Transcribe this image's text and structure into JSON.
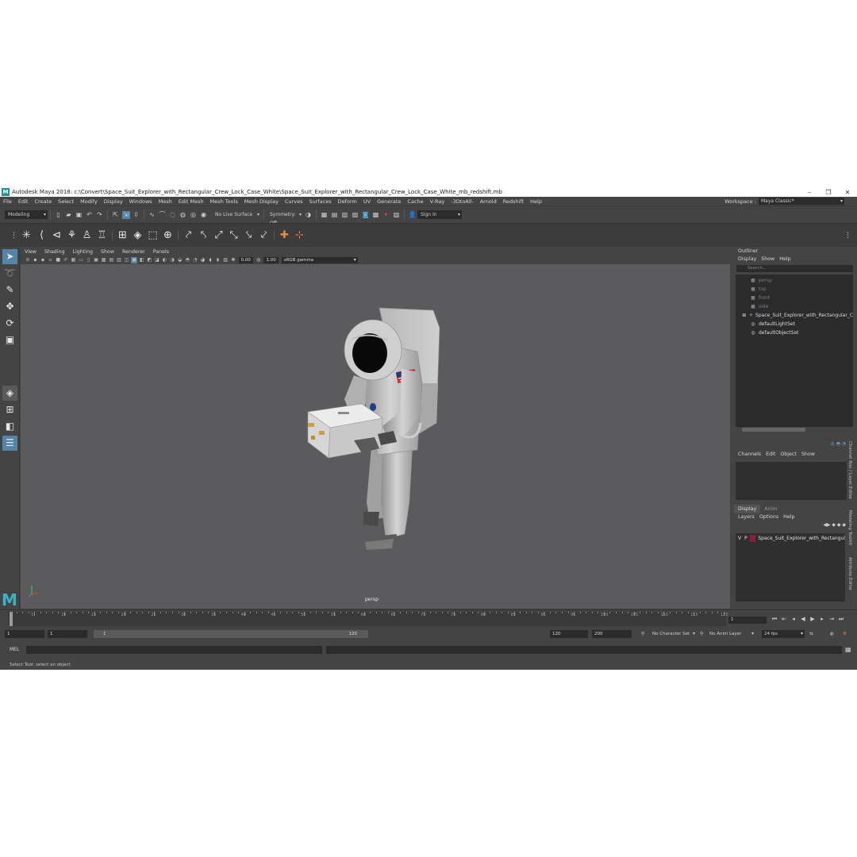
{
  "window": {
    "app_title": "Autodesk Maya 2018: c:\\Convert\\Space_Suit_Explorer_with_Rectangular_Crew_Lock_Case_White\\Space_Suit_Explorer_with_Rectangular_Crew_Lock_Case_White_mb_redshift.mb",
    "minimize": "–",
    "maximize": "❐",
    "close": "✕"
  },
  "menu": [
    "File",
    "Edit",
    "Create",
    "Select",
    "Modify",
    "Display",
    "Windows",
    "Mesh",
    "Edit Mesh",
    "Mesh Tools",
    "Mesh Display",
    "Curves",
    "Surfaces",
    "Deform",
    "UV",
    "Generate",
    "Cache",
    "V-Ray",
    "-3DtoAll-",
    "Arnold",
    "Redshift",
    "Help"
  ],
  "workspace": {
    "label": "Workspace :",
    "value": "Maya Classic*"
  },
  "status": {
    "mode": "Modeling",
    "live_surface": "No Live Surface",
    "symmetry": "Symmetry: Off",
    "sign_in": "Sign In"
  },
  "viewport": {
    "menu": [
      "View",
      "Shading",
      "Lighting",
      "Show",
      "Renderer",
      "Panels"
    ],
    "exposure": "0.00",
    "gamma": "1.00",
    "color_space": "sRGB gamma",
    "camera_label": "persp"
  },
  "outliner": {
    "title": "Outliner",
    "menu": [
      "Display",
      "Show",
      "Help"
    ],
    "search_placeholder": "Search...",
    "items": [
      {
        "label": "persp",
        "dim": true,
        "icon": "camera-icon"
      },
      {
        "label": "top",
        "dim": true,
        "icon": "camera-icon"
      },
      {
        "label": "front",
        "dim": true,
        "icon": "camera-icon"
      },
      {
        "label": "side",
        "dim": true,
        "icon": "camera-icon"
      },
      {
        "label": "Space_Suit_Explorer_with_Rectangular_C",
        "dim": false,
        "icon": "group-icon"
      },
      {
        "label": "defaultLightSet",
        "dim": false,
        "icon": "set-icon"
      },
      {
        "label": "defaultObjectSet",
        "dim": false,
        "icon": "set-icon"
      }
    ]
  },
  "channels": {
    "menu": [
      "Channels",
      "Edit",
      "Object",
      "Show"
    ]
  },
  "layers": {
    "tabs": [
      "Display",
      "Anim"
    ],
    "menu": [
      "Layers",
      "Options",
      "Help"
    ],
    "rows": [
      {
        "v": "V",
        "p": "P",
        "name": "Space_Suit_Explorer_with_Rectangul"
      }
    ],
    "swatch_color": "#8a1f3a"
  },
  "side_tabs": [
    "Channel Box / Layer Editor",
    "Modeling Toolkit",
    "Attribute Editor"
  ],
  "timeline": {
    "ticks": [
      "5",
      "10",
      "15",
      "20",
      "25",
      "30",
      "35",
      "40",
      "45",
      "50",
      "55",
      "60",
      "65",
      "70",
      "75",
      "80",
      "85",
      "90",
      "95",
      "100",
      "105",
      "110",
      "115",
      "120"
    ],
    "current_frame": "1"
  },
  "range": {
    "start": "1",
    "playback_start": "1",
    "bar_start": "1",
    "bar_end": "120",
    "playback_end": "120",
    "end": "200",
    "character_set": "No Character Set",
    "anim_layer": "No Anim Layer",
    "fps": "24 fps"
  },
  "command": {
    "lang": "MEL"
  },
  "help_line": "Select Tool: select an object"
}
